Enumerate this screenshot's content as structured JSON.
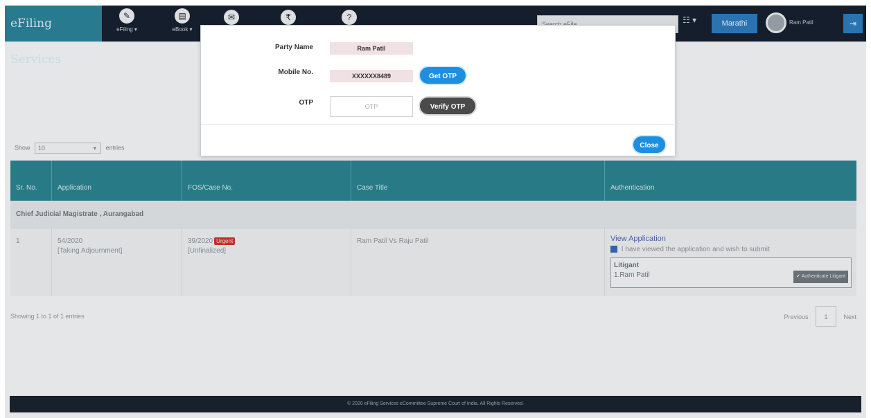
{
  "topbar": {
    "brand": "eFiling Services",
    "nav": [
      {
        "label": "eFiling ▾",
        "icon": "pencil-icon"
      },
      {
        "label": "eBook ▾",
        "icon": "book-icon"
      }
    ],
    "search_placeholder": "Search eFile",
    "grid_label": "☷ ▾",
    "language": "Marathi",
    "username": "Ram Patil",
    "logout_icon": "logout-icon"
  },
  "list": {
    "show_label": "Show",
    "show_value": "10",
    "entries_label": "entries",
    "columns": [
      "Sr. No.",
      "Application",
      "FOS/Case No.",
      "Case Title",
      "Authentication"
    ],
    "group": "Chief Judicial Magistrate , Aurangabad",
    "row": {
      "sr": "1",
      "application": "54/2020",
      "application_type": "[Taking Adjournment]",
      "case_no": "39/2020",
      "badge": "Urgent",
      "case_status": "[Unfinalized]",
      "case_title": "Ram Patil Vs Raju Patil",
      "view_link": "View Application",
      "consent_text": "I have viewed the application and wish to submit",
      "litigant_heading": "Litigant",
      "litigant_name": "1.Ram Patil",
      "authenticate_button": "✔ Authenticate Litigant"
    },
    "summary": "Showing 1 to 1 of 1 entries",
    "pager": {
      "previous": "Previous",
      "page": "1",
      "next": "Next"
    }
  },
  "footer": {
    "text": "© 2020 eFiling Services eCommittee Supreme Court of India. All Rights Reserved."
  },
  "modal": {
    "party_name_label": "Party Name",
    "party_name_value": "Ram Patil",
    "mobile_label": "Mobile No.",
    "mobile_value": "XXXXXX8489",
    "get_otp": "Get OTP",
    "otp_label": "OTP",
    "otp_placeholder": "OTP",
    "verify_otp": "Verify OTP",
    "close": "Close"
  }
}
